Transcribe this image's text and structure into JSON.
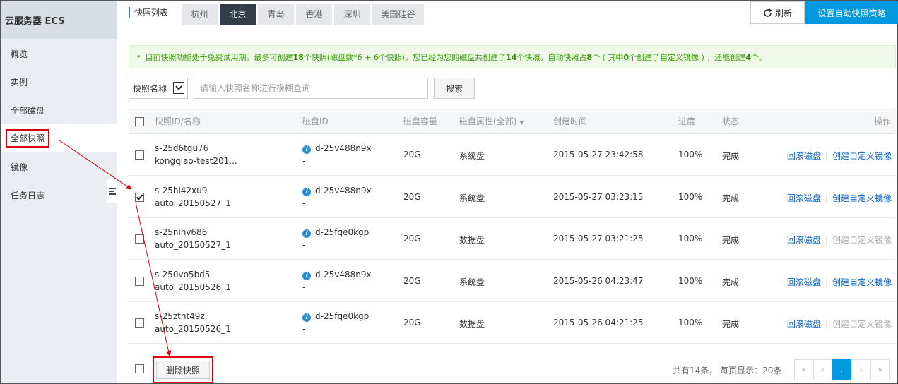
{
  "sidebar": {
    "title": "云服务器 ECS",
    "items": [
      {
        "label": "概览"
      },
      {
        "label": "实例"
      },
      {
        "label": "全部磁盘"
      },
      {
        "label": "全部快照",
        "active": true
      },
      {
        "label": "镜像"
      },
      {
        "label": "任务日志"
      }
    ],
    "toggle_icon": "collapse-icon"
  },
  "header": {
    "title": "快照列表",
    "regions": [
      "杭州",
      "北京",
      "青岛",
      "香港",
      "深圳",
      "美国硅谷"
    ],
    "active_region": "北京",
    "refresh_label": "刷新",
    "policy_label": "设置自动快照策略"
  },
  "notice": {
    "p1": "目前快照功能处于免费试用期。最多可创建",
    "n1": "18",
    "p2": "个快照(磁盘数*6 + 6个快照)。您已经为您的磁盘共创建了",
    "n2": "14",
    "p3": "个快照，自动快照占",
    "n3": "8",
    "p4": "个 ( 其中",
    "n4": "0",
    "p5": "个创建了自定义镜像 ) ，还能创建",
    "n5": "4",
    "p6": "个。"
  },
  "search": {
    "filter_label": "快照名称",
    "placeholder": "请输入快照名称进行模糊查询",
    "button_label": "搜索"
  },
  "table": {
    "headers": {
      "id_name": "快照ID/名称",
      "disk_id": "磁盘ID",
      "capacity": "磁盘容量",
      "attr": "磁盘属性(全部)",
      "created": "创建时间",
      "progress": "进度",
      "status": "状态",
      "actions": "操作"
    },
    "rows": [
      {
        "id": "s-25d6tgu76",
        "name": "kongqiao-test201...",
        "disk": "d-25v488n9x",
        "disk_sub": "-",
        "capacity": "20G",
        "attr": "系统盘",
        "created": "2015-05-27 23:42:58",
        "progress": "100%",
        "status": "完成",
        "rollback": "回滚磁盘",
        "create_image": "创建自定义镜像",
        "create_image_enabled": true,
        "checked": false
      },
      {
        "id": "s-25hi42xu9",
        "name": "auto_20150527_1",
        "disk": "d-25v488n9x",
        "disk_sub": "-",
        "capacity": "20G",
        "attr": "系统盘",
        "created": "2015-05-27 03:23:15",
        "progress": "100%",
        "status": "完成",
        "rollback": "回滚磁盘",
        "create_image": "创建自定义镜像",
        "create_image_enabled": true,
        "checked": true
      },
      {
        "id": "s-25nihv686",
        "name": "auto_20150527_1",
        "disk": "d-25fqe0kgp",
        "disk_sub": "-",
        "capacity": "20G",
        "attr": "数据盘",
        "created": "2015-05-27 03:21:25",
        "progress": "100%",
        "status": "完成",
        "rollback": "回滚磁盘",
        "create_image": "创建自定义镜像",
        "create_image_enabled": false,
        "checked": false
      },
      {
        "id": "s-250vo5bd5",
        "name": "auto_20150526_1",
        "disk": "d-25v488n9x",
        "disk_sub": "-",
        "capacity": "20G",
        "attr": "系统盘",
        "created": "2015-05-26 04:23:47",
        "progress": "100%",
        "status": "完成",
        "rollback": "回滚磁盘",
        "create_image": "创建自定义镜像",
        "create_image_enabled": true,
        "checked": false
      },
      {
        "id": "s-25ztht49z",
        "name": "auto_20150526_1",
        "disk": "d-25fqe0kgp",
        "disk_sub": "-",
        "capacity": "20G",
        "attr": "数据盘",
        "created": "2015-05-26 04:21:25",
        "progress": "100%",
        "status": "完成",
        "rollback": "回滚磁盘",
        "create_image": "创建自定义镜像",
        "create_image_enabled": false,
        "checked": false
      }
    ]
  },
  "footer": {
    "delete_label": "删除快照",
    "total_text": "共有14条， 每页显示：20条",
    "pager": [
      "«",
      "‹",
      ".",
      "›",
      "»"
    ],
    "current_page_index": 2
  },
  "colors": {
    "accent": "#0099e0",
    "annotation": "#d6000f",
    "notice_text": "#33a000"
  }
}
